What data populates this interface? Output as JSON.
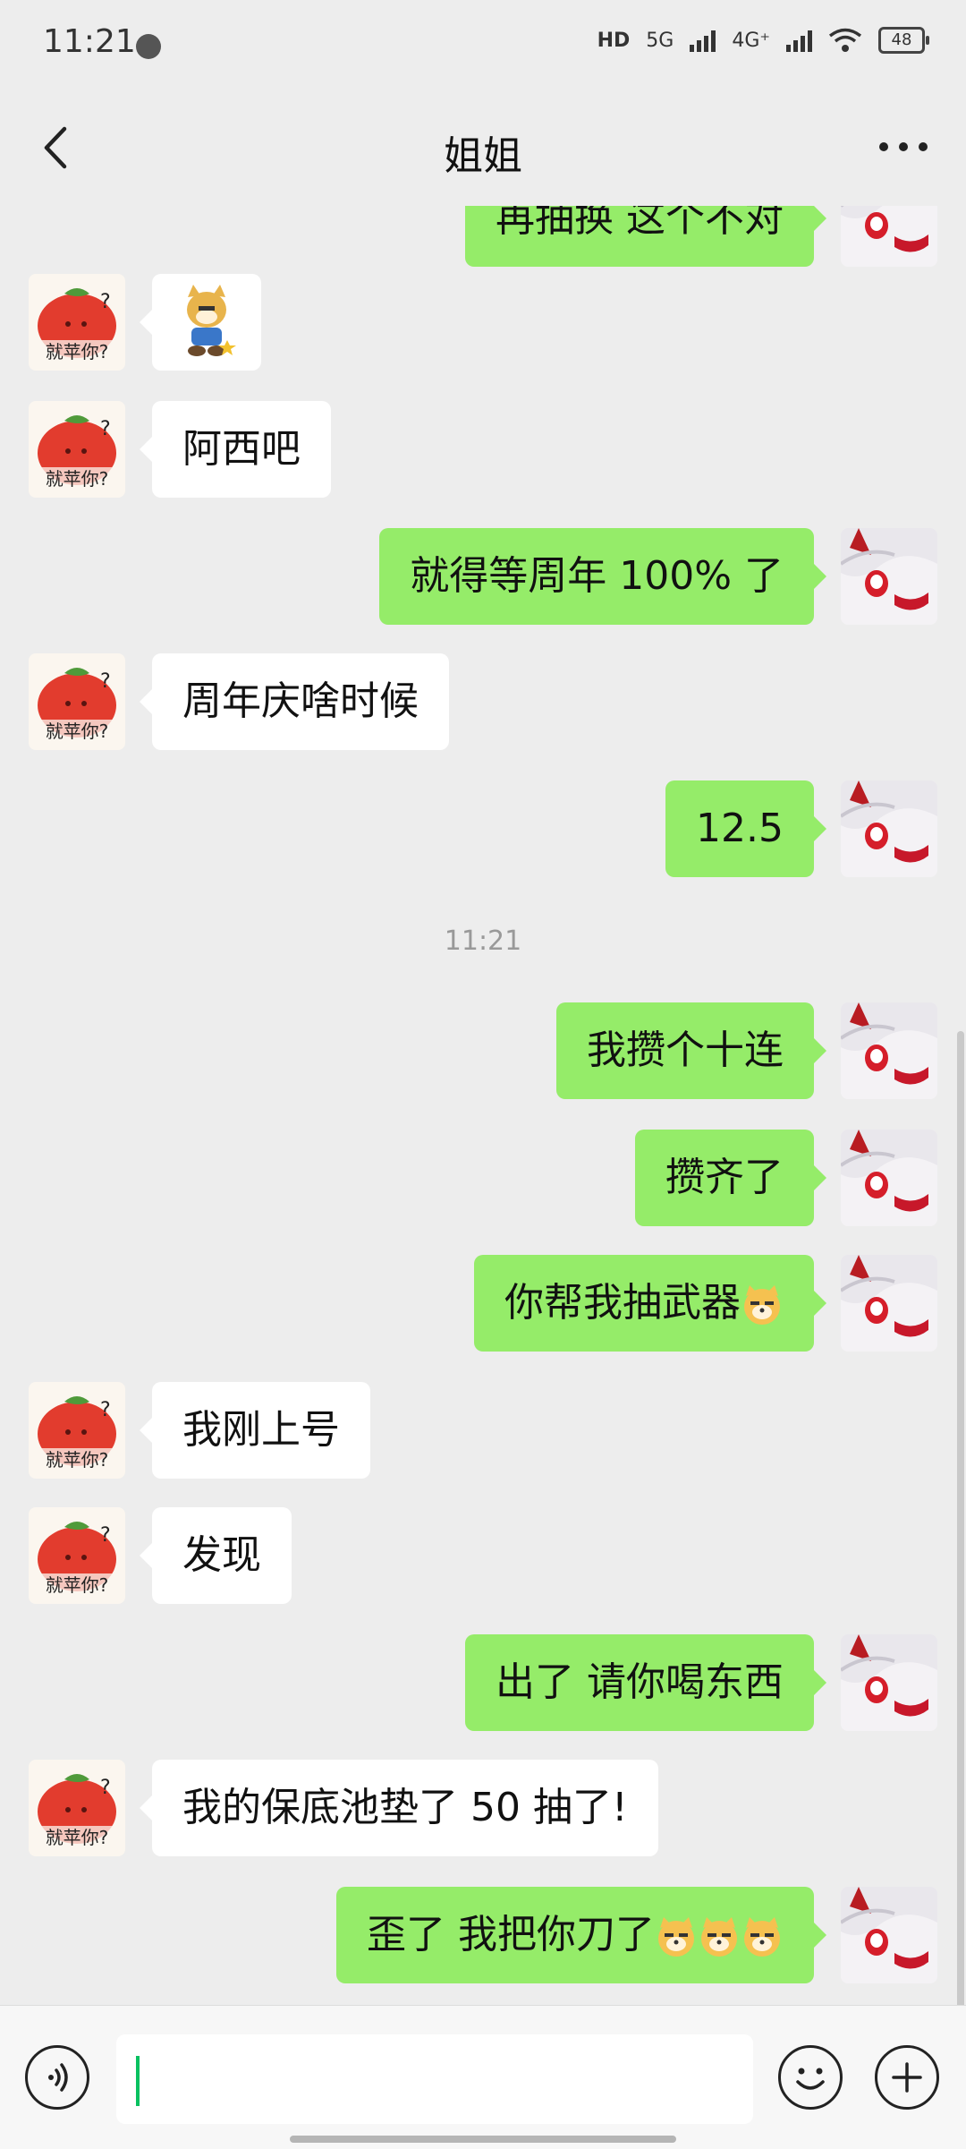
{
  "status_bar": {
    "time": "11:21",
    "network_5g": "5G",
    "network_4g": "4G⁺",
    "hd": "HD",
    "battery": "48"
  },
  "header": {
    "title": "姐姐"
  },
  "colors": {
    "outgoing_bubble": "#95ec69",
    "incoming_bubble": "#ffffff",
    "chat_bg": "#ededed",
    "accent": "#07c160"
  },
  "messages": [
    {
      "side": "right",
      "text": "再抽换 这个不对",
      "partial": true
    },
    {
      "side": "left",
      "type": "sticker",
      "sticker": "doge-sticker"
    },
    {
      "side": "left",
      "text": "阿西吧"
    },
    {
      "side": "right",
      "text": "就得等周年 100% 了"
    },
    {
      "side": "left",
      "text": "周年庆啥时候"
    },
    {
      "side": "right",
      "text": "12.5"
    },
    {
      "type": "time",
      "text": "11:21"
    },
    {
      "side": "right",
      "text": "我攒个十连"
    },
    {
      "side": "right",
      "text": "攒齐了"
    },
    {
      "side": "right",
      "text": "你帮我抽武器",
      "emoji_count": 1
    },
    {
      "side": "left",
      "text": "我刚上号"
    },
    {
      "side": "left",
      "text": "发现"
    },
    {
      "side": "right",
      "text": "出了 请你喝东西"
    },
    {
      "side": "left",
      "text": "我的保底池垫了 50 抽了!"
    },
    {
      "side": "right",
      "text": "歪了 我把你刀了",
      "emoji_count": 3
    }
  ],
  "avatars": {
    "contact_caption": "就苹你?",
    "contact_icon": "tomato-avatar",
    "self_icon": "anime-girl-avatar"
  },
  "input_bar": {
    "value": "",
    "icons": [
      "voice-icon",
      "emoji-icon",
      "plus-icon"
    ]
  }
}
